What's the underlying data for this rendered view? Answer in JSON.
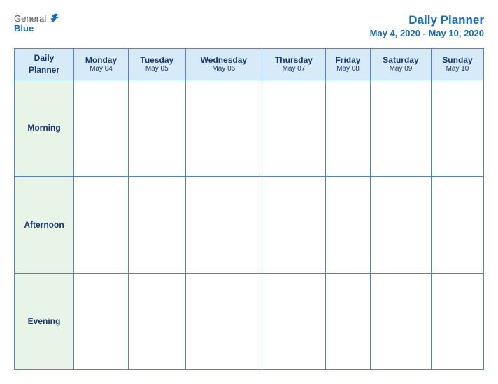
{
  "header": {
    "logo_general": "General",
    "logo_blue": "Blue",
    "title": "Daily Planner",
    "date_range": "May 4, 2020 - May 10, 2020"
  },
  "table": {
    "header_col_label": "Daily\nPlanner",
    "days": [
      {
        "name": "Monday",
        "date": "May 04"
      },
      {
        "name": "Tuesday",
        "date": "May 05"
      },
      {
        "name": "Wednesday",
        "date": "May 06"
      },
      {
        "name": "Thursday",
        "date": "May 07"
      },
      {
        "name": "Friday",
        "date": "May 08"
      },
      {
        "name": "Saturday",
        "date": "May 09"
      },
      {
        "name": "Sunday",
        "date": "May 10"
      }
    ],
    "rows": [
      {
        "label": "Morning"
      },
      {
        "label": "Afternoon"
      },
      {
        "label": "Evening"
      }
    ]
  }
}
